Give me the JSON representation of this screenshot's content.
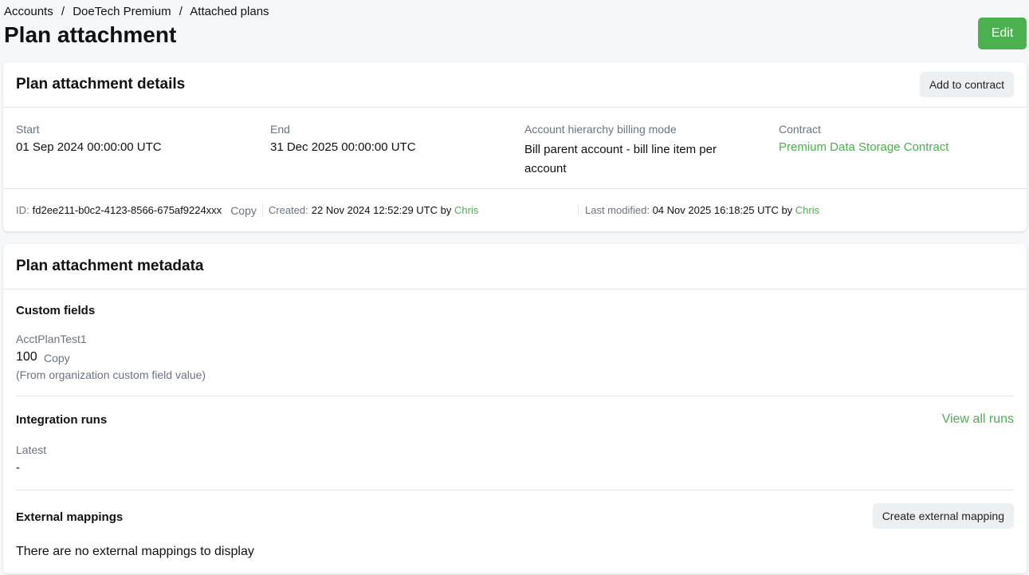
{
  "breadcrumb": [
    "Accounts",
    "DoeTech Premium",
    "Attached plans"
  ],
  "sep": "/",
  "title": "Plan attachment",
  "edit": "Edit",
  "details": {
    "title": "Plan attachment details",
    "add": "Add to contract",
    "start_label": "Start",
    "start": "01 Sep 2024 00:00:00 UTC",
    "end_label": "End",
    "end": "31 Dec 2025 00:00:00 UTC",
    "mode_label": "Account hierarchy billing mode",
    "mode": "Bill parent account - bill line item per account",
    "contract_label": "Contract",
    "contract": "Premium Data Storage Contract",
    "id_label": "ID:",
    "id": "fd2ee211-b0c2-4123-8566-675af9224xxx",
    "copy": "Copy",
    "created_label": "Created:",
    "created": "22 Nov 2024 12:52:29 UTC by",
    "created_by": "Chris",
    "modified_label": "Last modified:",
    "modified": "04 Nov 2025 16:18:25 UTC by",
    "modified_by": "Chris"
  },
  "metadata": {
    "title": "Plan attachment metadata",
    "custom_fields": "Custom fields",
    "field_name": "AcctPlanTest1",
    "field_value": "100",
    "copy": "Copy",
    "field_note": "(From organization custom field value)",
    "integration": "Integration runs",
    "view_all": "View all runs",
    "latest_label": "Latest",
    "latest": "-",
    "external": "External mappings",
    "create": "Create external mapping",
    "empty": "There are no external mappings to display"
  }
}
